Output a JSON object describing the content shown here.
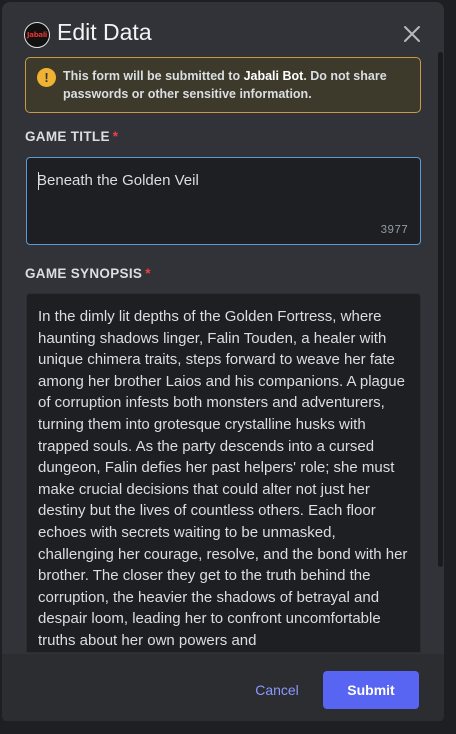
{
  "modal": {
    "title": "Edit Data",
    "app_logo_text": "Jabali",
    "close_icon": "close-icon"
  },
  "notice": {
    "icon": "warning-icon",
    "text_prefix": "This form will be submitted to ",
    "bot_name": "Jabali Bot",
    "text_suffix": ". Do not share passwords or other sensitive information."
  },
  "fields": {
    "title": {
      "label": "GAME TITLE",
      "required_mark": "*",
      "value": "Beneath the Golden Veil",
      "remaining": "3977"
    },
    "synopsis": {
      "label": "GAME SYNOPSIS",
      "required_mark": "*",
      "value": "In the dimly lit depths of the Golden Fortress, where haunting shadows linger, Falin Touden, a healer with unique chimera traits, steps forward to weave her fate among her brother Laios and his companions. A plague of corruption infests both monsters and adventurers, turning them into grotesque crystalline husks with trapped souls. As the party descends into a cursed dungeon, Falin defies her past helpers' role; she must make crucial decisions that could alter not just her destiny but the lives of countless others. Each floor echoes with secrets waiting to be unmasked, challenging her courage, resolve, and the bond with her brother. The closer they get to the truth behind the corruption, the heavier the shadows of betrayal and despair loom, leading her to confront uncomfortable truths about her own powers and"
    }
  },
  "footer": {
    "cancel_label": "Cancel",
    "submit_label": "Submit"
  },
  "colors": {
    "modal_bg": "#313338",
    "footer_bg": "#2b2d31",
    "input_bg": "#1e1f22",
    "accent": "#5865f2",
    "link": "#8b98ff",
    "required": "#f23f43",
    "warning": "#f0b232",
    "focus_border": "#5b9bd5"
  }
}
